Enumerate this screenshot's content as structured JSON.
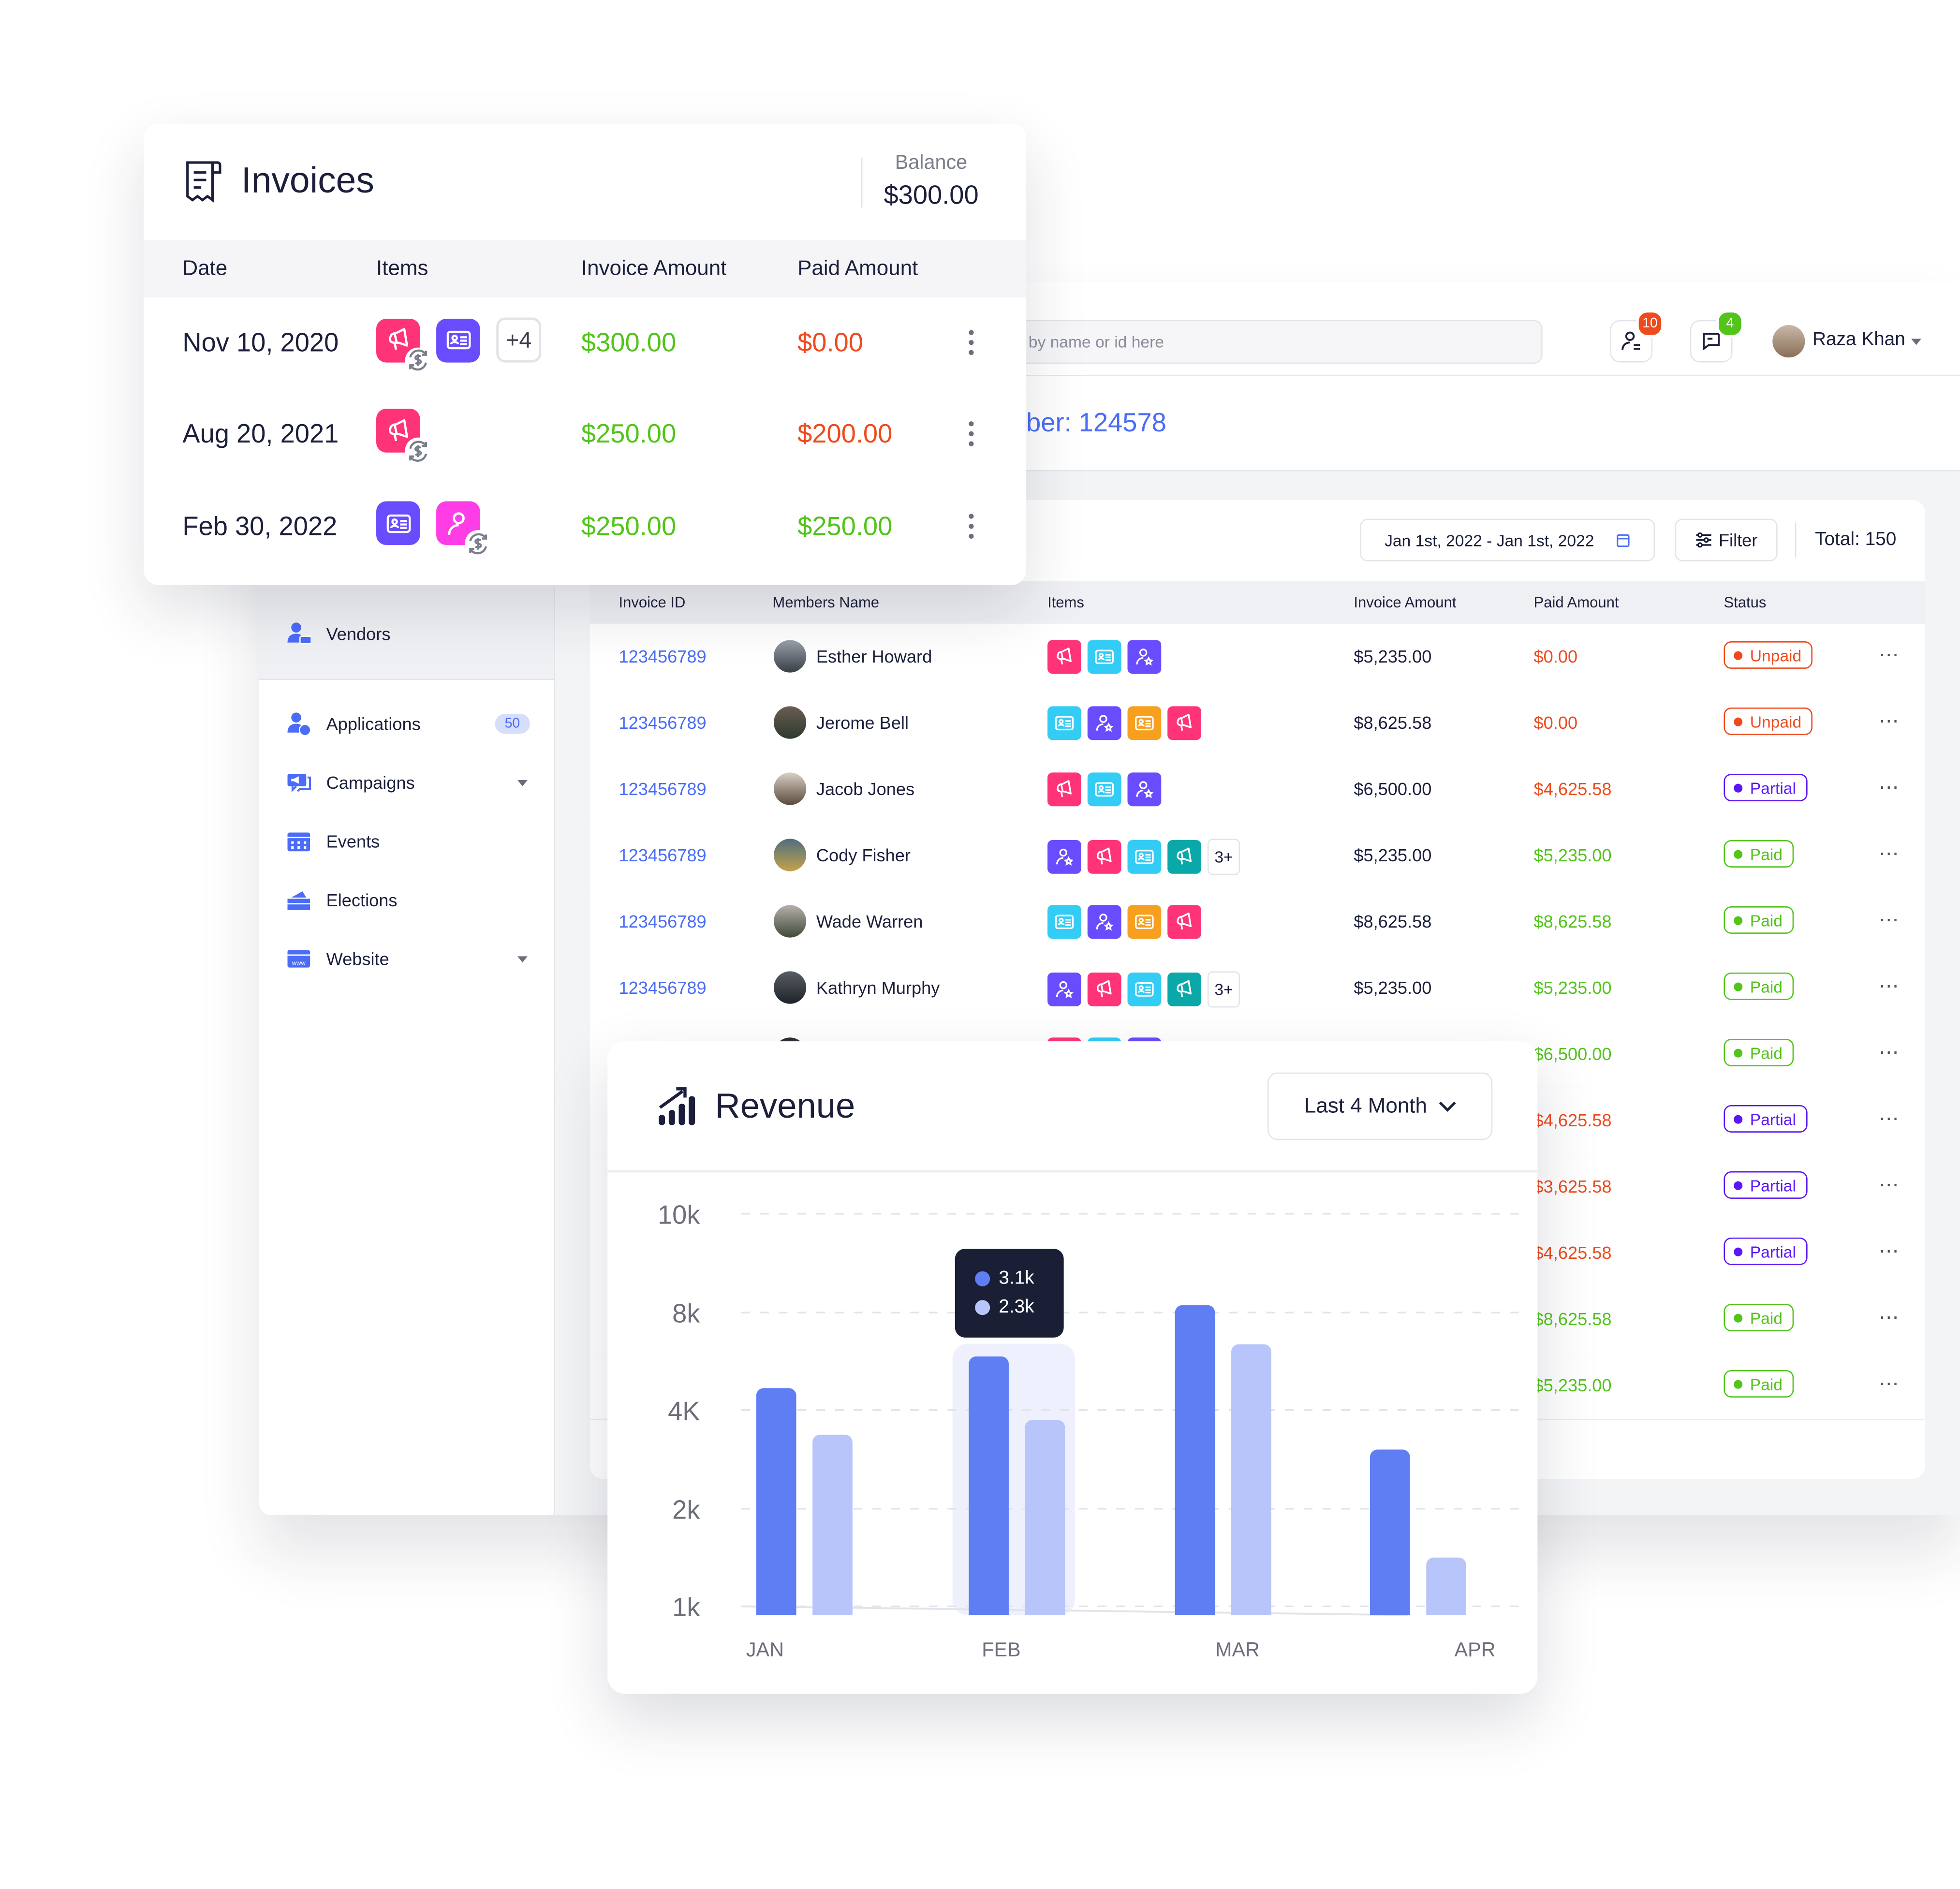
{
  "colors": {
    "accent": "#4a6cf7",
    "red": "#ef4a1d",
    "green": "#52c41a",
    "purple": "#5b16f5",
    "pink": "#ff3377",
    "cyan": "#33ccf5",
    "violet": "#6a4cff",
    "orange": "#f7a01f",
    "teal": "#0aa8a8",
    "magenta": "#ff3de6",
    "bar_primary": "#5f7ef3",
    "bar_secondary": "#b8c5fa",
    "tooltip_bg": "#1a1f36"
  },
  "header": {
    "search_placeholder": "Search by name or id here",
    "notifications_count": "10",
    "messages_count": "4",
    "user_name": "Raza Khan"
  },
  "page": {
    "title_fragment": "ber: 124578"
  },
  "sidebar": {
    "items": [
      {
        "label": "Vendors",
        "icon": "vendor-icon"
      },
      {
        "label": "Applications",
        "icon": "application-icon",
        "badge": "50"
      },
      {
        "label": "Campaigns",
        "icon": "campaign-icon",
        "has_dropdown": true
      },
      {
        "label": "Events",
        "icon": "calendar-icon"
      },
      {
        "label": "Elections",
        "icon": "ballot-icon"
      },
      {
        "label": "Website",
        "icon": "website-icon",
        "has_dropdown": true
      }
    ]
  },
  "toolbar": {
    "date_range": "Jan 1st, 2022 - Jan 1st, 2022",
    "filter_label": "Filter",
    "total": "Total: 150"
  },
  "table": {
    "columns": [
      "Invoice ID",
      "Members Name",
      "Items",
      "Invoice Amount",
      "Paid Amount",
      "Status"
    ],
    "rows": [
      {
        "id": "123456789",
        "name": "Esther Howard",
        "items": [
          [
            "megaphone",
            "pink"
          ],
          [
            "idcard",
            "cyan"
          ],
          [
            "userstar",
            "violet"
          ]
        ],
        "more": "",
        "amount": "$5,235.00",
        "paid": "$0.00",
        "paid_color": "red",
        "status": "Unpaid"
      },
      {
        "id": "123456789",
        "name": "Jerome Bell",
        "items": [
          [
            "idcard",
            "cyan"
          ],
          [
            "userstar",
            "violet"
          ],
          [
            "idcard",
            "orange"
          ],
          [
            "megaphone",
            "pink"
          ]
        ],
        "more": "",
        "amount": "$8,625.58",
        "paid": "$0.00",
        "paid_color": "red",
        "status": "Unpaid"
      },
      {
        "id": "123456789",
        "name": "Jacob Jones",
        "items": [
          [
            "megaphone",
            "pink"
          ],
          [
            "idcard",
            "cyan"
          ],
          [
            "userstar",
            "violet"
          ]
        ],
        "more": "",
        "amount": "$6,500.00",
        "paid": "$4,625.58",
        "paid_color": "red",
        "status": "Partial"
      },
      {
        "id": "123456789",
        "name": "Cody Fisher",
        "items": [
          [
            "userstar",
            "violet"
          ],
          [
            "megaphone",
            "pink"
          ],
          [
            "idcard",
            "cyan"
          ],
          [
            "megaphone",
            "teal"
          ]
        ],
        "more": "3+",
        "amount": "$5,235.00",
        "paid": "$5,235.00",
        "paid_color": "green",
        "status": "Paid"
      },
      {
        "id": "123456789",
        "name": "Wade Warren",
        "items": [
          [
            "idcard",
            "cyan"
          ],
          [
            "userstar",
            "violet"
          ],
          [
            "idcard",
            "orange"
          ],
          [
            "megaphone",
            "pink"
          ]
        ],
        "more": "",
        "amount": "$8,625.58",
        "paid": "$8,625.58",
        "paid_color": "green",
        "status": "Paid"
      },
      {
        "id": "123456789",
        "name": "Kathryn Murphy",
        "items": [
          [
            "userstar",
            "violet"
          ],
          [
            "megaphone",
            "pink"
          ],
          [
            "idcard",
            "cyan"
          ],
          [
            "megaphone",
            "teal"
          ]
        ],
        "more": "3+",
        "amount": "$5,235.00",
        "paid": "$5,235.00",
        "paid_color": "green",
        "status": "Paid"
      },
      {
        "items": [
          [
            "megaphone",
            "pink"
          ],
          [
            "idcard",
            "cyan"
          ],
          [
            "userstar",
            "violet"
          ]
        ],
        "paid": "$6,500.00",
        "paid_color": "green",
        "status": "Paid"
      },
      {
        "items": [],
        "paid": "$4,625.58",
        "paid_color": "red",
        "status": "Partial"
      },
      {
        "items": [],
        "paid": "$3,625.58",
        "paid_color": "red",
        "status": "Partial"
      },
      {
        "items": [],
        "paid": "$4,625.58",
        "paid_color": "red",
        "status": "Partial"
      },
      {
        "items": [],
        "paid": "$8,625.58",
        "paid_color": "green",
        "status": "Paid"
      },
      {
        "items": [],
        "paid": "$5,235.00",
        "paid_color": "green",
        "status": "Paid"
      }
    ]
  },
  "invoices": {
    "title": "Invoices",
    "balance_label": "Balance",
    "balance_value": "$300.00",
    "columns": [
      "Date",
      "Items",
      "Invoice Amount",
      "Paid Amount"
    ],
    "rows": [
      {
        "date": "Nov 10, 2020",
        "items": [
          [
            "megaphone",
            "pink",
            true
          ],
          [
            "idcard",
            "violet",
            false
          ]
        ],
        "more": "+4",
        "amount": "$300.00",
        "paid": "$0.00",
        "paid_color": "red"
      },
      {
        "date": "Aug 20, 2021",
        "items": [
          [
            "megaphone",
            "pink",
            true
          ]
        ],
        "more": "",
        "amount": "$250.00",
        "paid": "$200.00",
        "paid_color": "red"
      },
      {
        "date": "Feb 30, 2022",
        "items": [
          [
            "idcard",
            "violet",
            false
          ],
          [
            "user",
            "magenta",
            true
          ]
        ],
        "more": "",
        "amount": "$250.00",
        "paid": "$250.00",
        "paid_color": "green"
      }
    ]
  },
  "revenue": {
    "title": "Revenue",
    "period_select": "Last 4 Month",
    "tooltip": [
      "3.1k",
      "2.3k"
    ]
  },
  "chart_data": {
    "type": "bar",
    "title": "Revenue",
    "categories": [
      "JAN",
      "FEB",
      "MAR",
      "APR"
    ],
    "series": [
      {
        "values": [
          4900,
          6200,
          8150,
          3200
        ]
      },
      {
        "values": [
          3500,
          3800,
          6700,
          1500
        ]
      }
    ],
    "y_ticks": [
      1000,
      2000,
      4000,
      8000,
      10000
    ],
    "y_tick_labels": [
      "1k",
      "2k",
      "4K",
      "8k",
      "10k"
    ],
    "y_scale": "non-uniform (ticks equally spaced)",
    "grid": "dashed horizontal",
    "highlighted_category": "FEB",
    "legend": "none"
  }
}
